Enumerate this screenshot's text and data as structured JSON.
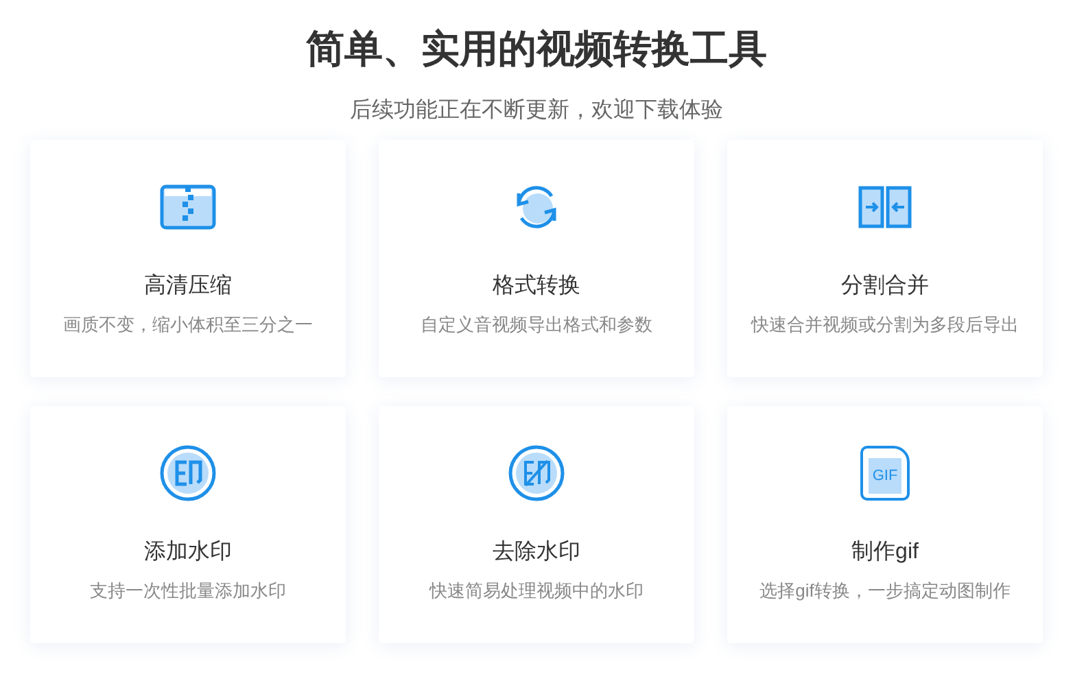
{
  "title": "简单、实用的视频转换工具",
  "subtitle": "后续功能正在不断更新，欢迎下载体验",
  "features": [
    {
      "kind": "compress",
      "name": "高清压缩",
      "description": "画质不变，缩小体积至三分之一"
    },
    {
      "kind": "convert",
      "name": "格式转换",
      "description": "自定义音视频导出格式和参数"
    },
    {
      "kind": "split",
      "name": "分割合并",
      "description": "快速合并视频或分割为多段后导出"
    },
    {
      "kind": "watermark-add",
      "name": "添加水印",
      "description": "支持一次性批量添加水印"
    },
    {
      "kind": "watermark-remove",
      "name": "去除水印",
      "description": "快速简易处理视频中的水印"
    },
    {
      "kind": "gif",
      "name": "制作gif",
      "description": "选择gif转换，一步搞定动图制作",
      "icon_text": "GIF"
    }
  ]
}
